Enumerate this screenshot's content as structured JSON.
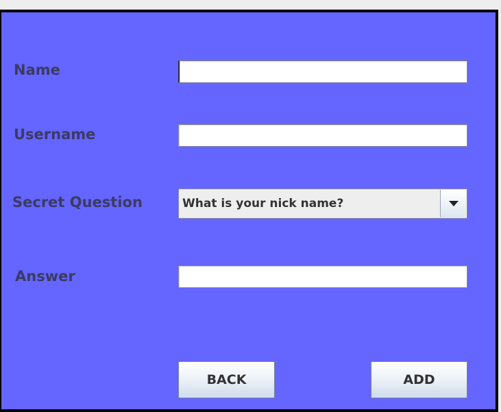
{
  "form": {
    "name_label": "Name",
    "name_value": "",
    "username_label": "Username",
    "username_value": "",
    "secret_question_label": "Secret Question",
    "secret_question_selected": "What is your nick name?",
    "answer_label": "Answer",
    "answer_value": ""
  },
  "buttons": {
    "back_label": "BACK",
    "add_label": "ADD"
  },
  "icons": {
    "dropdown": "chevron-down-icon"
  },
  "colors": {
    "panel_background": "#6565ff",
    "label_text": "#3b3b63",
    "window_background": "#eeeeee"
  }
}
